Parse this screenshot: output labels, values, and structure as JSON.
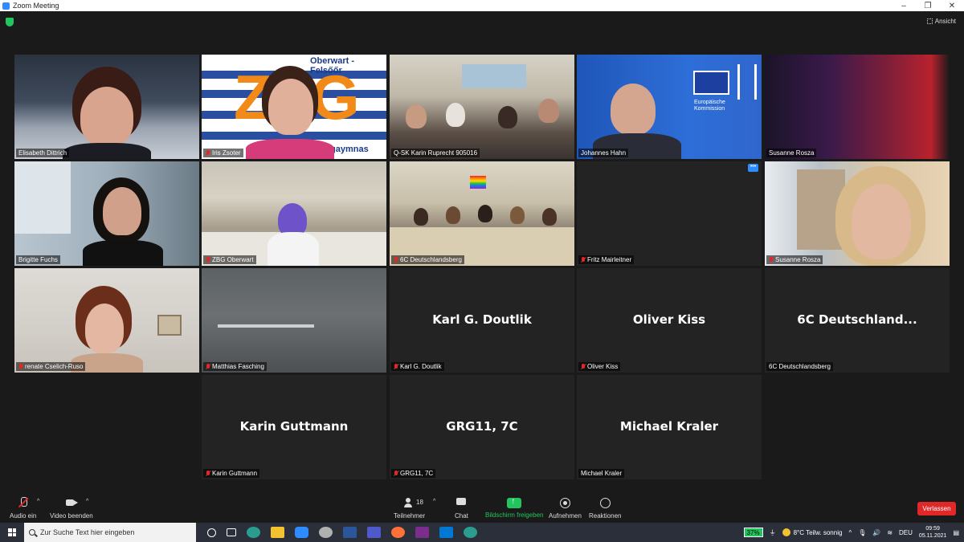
{
  "window": {
    "title": "Zoom Meeting"
  },
  "topbar": {
    "view_label": "Ansicht"
  },
  "tiles": [
    {
      "name": "Elisabeth Dittrich",
      "muted": false
    },
    {
      "name": "Iris Zsoter",
      "muted": true,
      "overlay_text_1": "Oberwart - Felsőőr",
      "overlay_text_2": "ZBG",
      "overlay_text_3": "gaymnas"
    },
    {
      "name": "Q-SK Karin Ruprecht 905016",
      "muted": false
    },
    {
      "name": "Johannes Hahn",
      "muted": false,
      "overlay_text_1": "Europäische",
      "overlay_text_2": "Kommission"
    },
    {
      "name": "Susanne Rosza",
      "muted": false
    },
    {
      "name": "Brigitte Fuchs",
      "muted": false
    },
    {
      "name": "ZBG Oberwart",
      "muted": true
    },
    {
      "name": "6C Deutschlandsberg",
      "muted": true
    },
    {
      "name": "Fritz Mairleitner",
      "muted": true
    },
    {
      "name": "Susanne Rosza",
      "muted": true
    },
    {
      "name": "renate Cselich-Ruso",
      "muted": true
    },
    {
      "name": "Matthias Fasching",
      "muted": true
    },
    {
      "name": "Karl G. Doutlik",
      "muted": true,
      "big_name": "Karl G. Doutlik"
    },
    {
      "name": "Oliver Kiss",
      "muted": true,
      "big_name": "Oliver Kiss"
    },
    {
      "name": "6C Deutschlandsberg",
      "muted": false,
      "big_name": "6C  Deutschland..."
    },
    {
      "name": "Karin Guttmann",
      "muted": true,
      "big_name": "Karin Guttmann"
    },
    {
      "name": "GRG11, 7C",
      "muted": true,
      "big_name": "GRG11, 7C"
    },
    {
      "name": "Michael Kraler",
      "muted": false,
      "big_name": "Michael Kraler"
    }
  ],
  "toolbar": {
    "audio_label": "Audio ein",
    "video_label": "Video beenden",
    "participants_label": "Teilnehmer",
    "participants_count": "18",
    "chat_label": "Chat",
    "share_label": "Bildschirm freigeben",
    "record_label": "Aufnehmen",
    "reactions_label": "Reaktionen",
    "leave_label": "Verlassen",
    "colors": {
      "leave": "#e02828",
      "share": "#23c55e"
    }
  },
  "taskbar": {
    "search_placeholder": "Zur Suche Text hier eingeben",
    "battery": "37%",
    "weather": "8°C  Teilw. sonnig",
    "language": "DEU",
    "time": "09:59",
    "date": "05.11.2021"
  }
}
